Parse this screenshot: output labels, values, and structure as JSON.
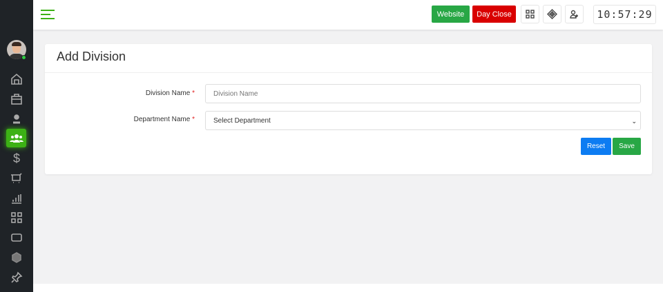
{
  "topbar": {
    "website_label": "Website",
    "day_close_label": "Day Close",
    "clock": "10:57:29"
  },
  "sidebar": {
    "items": [
      "home",
      "briefcase",
      "user",
      "users",
      "dollar",
      "cart",
      "chart",
      "apps",
      "tablet",
      "hexagon",
      "pin"
    ],
    "active": "users"
  },
  "form": {
    "title": "Add Division",
    "division_label": "Division Name",
    "division_placeholder": "Division Name",
    "division_value": "",
    "department_label": "Department Name",
    "department_selected": "Select Department",
    "required_mark": "*",
    "reset_label": "Reset",
    "save_label": "Save"
  },
  "colors": {
    "accent": "#3cb115",
    "website": "#28a745",
    "day_close": "#d90000",
    "reset": "#0d7cf2",
    "save": "#28a745"
  }
}
